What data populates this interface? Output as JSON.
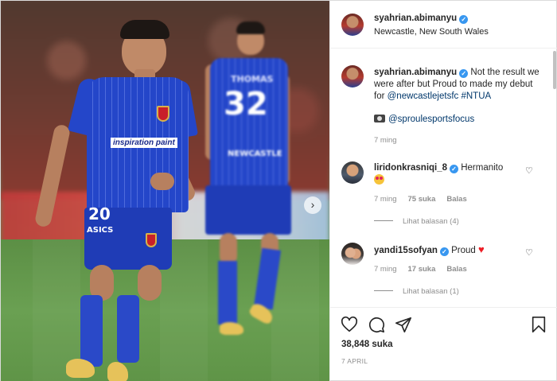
{
  "photo": {
    "front_player_number": "20",
    "back_player_number": "32",
    "back_player_name": "THOMAS",
    "sponsor_text": "inspiration paint",
    "shorts_brand": "ASICS",
    "back_sponsor": "NEWCASTLE",
    "next_glyph": "›"
  },
  "header": {
    "username": "syahrian.abimanyu",
    "location": "Newcastle, New South Wales",
    "verified_glyph": "✓"
  },
  "caption": {
    "username": "syahrian.abimanyu",
    "text": " Not the result we were after but Proud to made my debut for ",
    "mention": "@newcastlejetsfc",
    "hashtag": " #NTUA",
    "photo_credit": "@sproulesportsfocus",
    "time": "7 ming"
  },
  "comments": [
    {
      "username": "liridonkrasniqi_8",
      "text": " Hermanito",
      "time": "7 ming",
      "likes": "75 suka",
      "reply": "Balas",
      "view_replies": "Lihat balasan (4)"
    },
    {
      "username": "yandi15sofyan",
      "text": " Proud",
      "time": "7 ming",
      "likes": "17 suka",
      "reply": "Balas",
      "view_replies": "Lihat balasan (1)"
    }
  ],
  "actions": {
    "like_count": "38,848 suka",
    "date": "7 APRIL",
    "icons": [
      "heart-icon",
      "comment-icon",
      "share-icon",
      "bookmark-icon"
    ]
  },
  "colors": {
    "jersey": "#2446c9",
    "verified": "#3897f0",
    "link": "#00376b",
    "muted": "#8e8e8e"
  }
}
